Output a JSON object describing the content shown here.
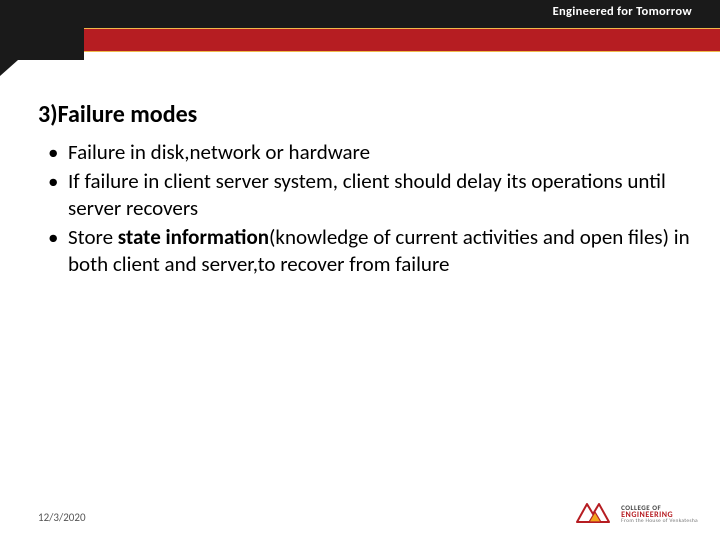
{
  "header": {
    "tagline": "Engineered for Tomorrow"
  },
  "content": {
    "heading": "3)Failure modes",
    "bullets": [
      {
        "text": "Failure in disk,network or hardware"
      },
      {
        "text": "If failure in client server system, client should delay its operations until server recovers"
      },
      {
        "prefix": "Store ",
        "bold": "state information",
        "suffix": "(knowledge of current activities and open files) in both client and server,to recover from failure"
      }
    ]
  },
  "footer": {
    "date": "12/3/2020"
  },
  "logo": {
    "line1": "COLLEGE OF",
    "line2": "ENGINEERING",
    "line3": "From the House of Venkatesha"
  }
}
